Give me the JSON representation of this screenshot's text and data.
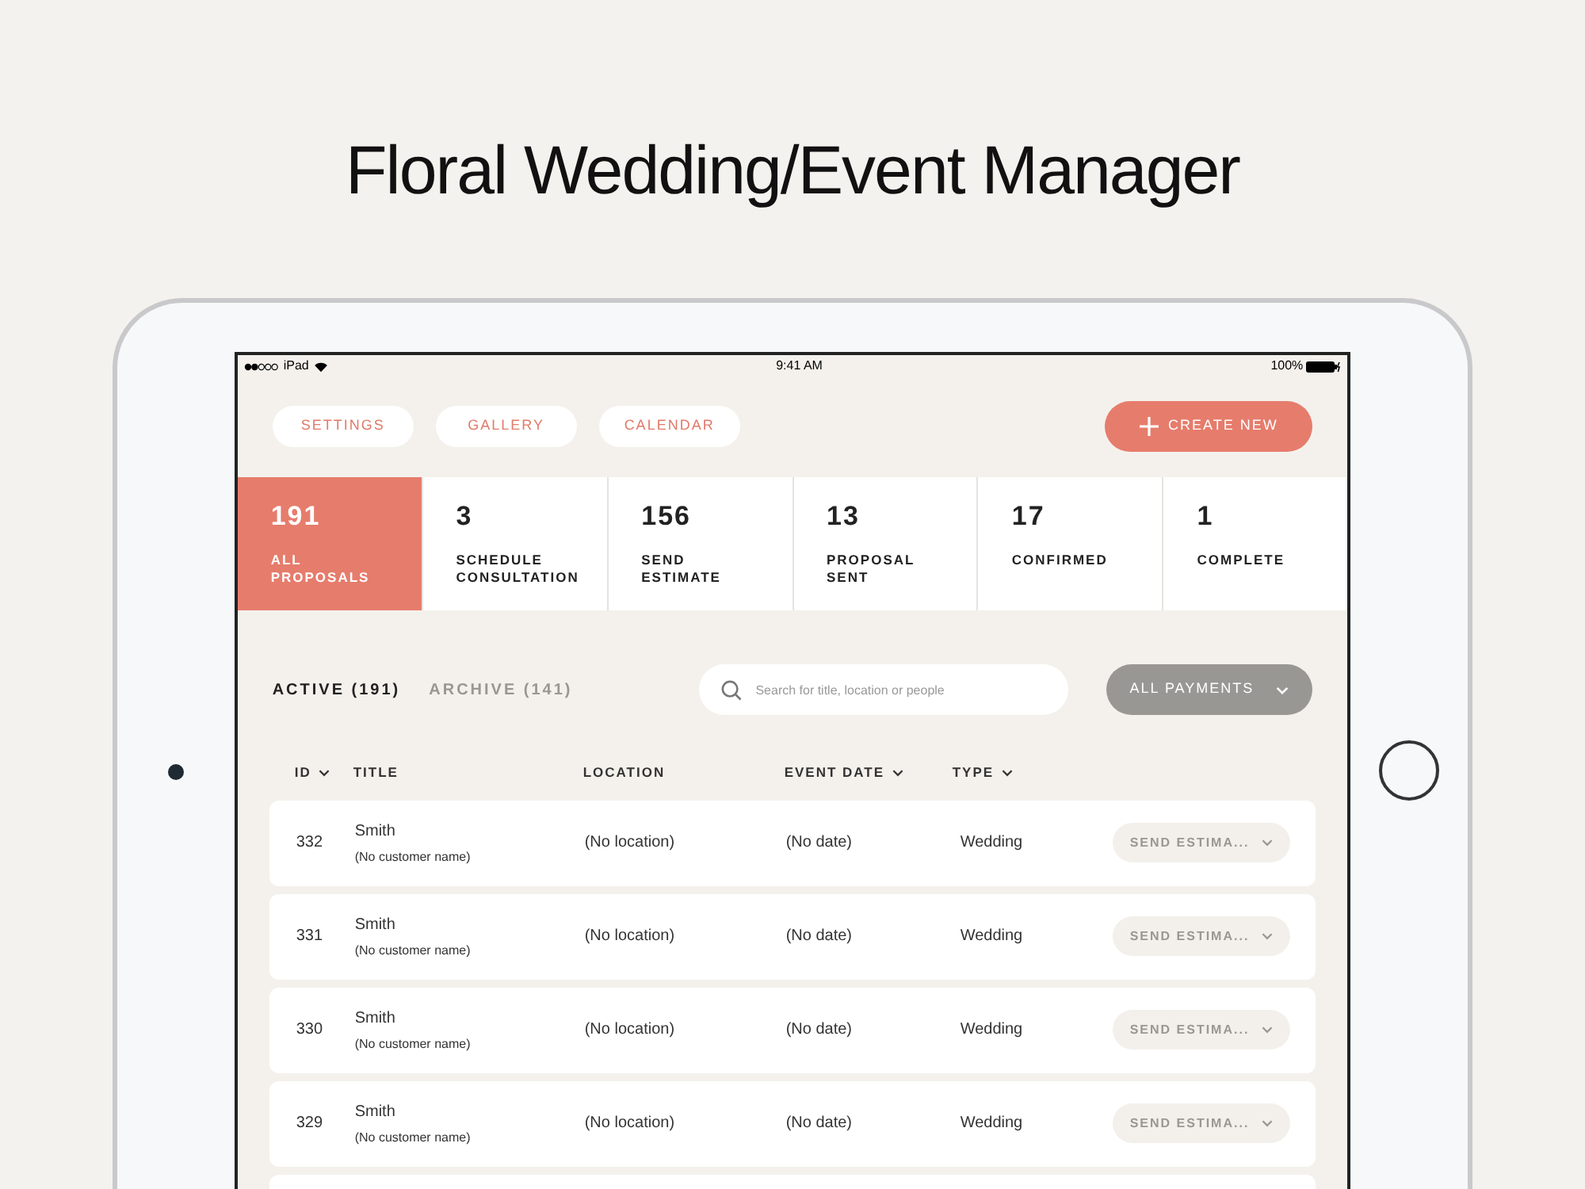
{
  "headline": "Floral Wedding/Event Manager",
  "status_bar": {
    "carrier": "iPad",
    "time": "9:41 AM",
    "battery": "100%"
  },
  "nav_buttons": [
    "SETTINGS",
    "GALLERY",
    "CALENDAR"
  ],
  "create_button": "CREATE NEW",
  "stats": [
    {
      "count": "191",
      "label": "ALL\nPROPOSALS",
      "selected": true
    },
    {
      "count": "3",
      "label": "SCHEDULE\nCONSULTATION",
      "selected": false
    },
    {
      "count": "156",
      "label": "SEND\nESTIMATE",
      "selected": false
    },
    {
      "count": "13",
      "label": "PROPOSAL\nSENT",
      "selected": false
    },
    {
      "count": "17",
      "label": "CONFIRMED",
      "selected": false
    },
    {
      "count": "1",
      "label": "COMPLETE",
      "selected": false
    }
  ],
  "tabs": [
    {
      "label": "ACTIVE (191)",
      "selected": true
    },
    {
      "label": "ARCHIVE (141)",
      "selected": false
    }
  ],
  "search": {
    "placeholder": "Search for title, location or people"
  },
  "payments_filter": "ALL PAYMENTS",
  "table": {
    "columns": [
      {
        "label": "ID",
        "sortable": true
      },
      {
        "label": "TITLE",
        "sortable": false
      },
      {
        "label": "LOCATION",
        "sortable": false
      },
      {
        "label": "EVENT DATE",
        "sortable": true
      },
      {
        "label": "TYPE",
        "sortable": true
      }
    ],
    "rows": [
      {
        "id": "332",
        "title": "Smith",
        "customer": "(No customer name)",
        "location": "(No location)",
        "date": "(No date)",
        "type": "Wedding",
        "status": "SEND ESTIMA..."
      },
      {
        "id": "331",
        "title": "Smith",
        "customer": "(No customer name)",
        "location": "(No location)",
        "date": "(No date)",
        "type": "Wedding",
        "status": "SEND ESTIMA..."
      },
      {
        "id": "330",
        "title": "Smith",
        "customer": "(No customer name)",
        "location": "(No location)",
        "date": "(No date)",
        "type": "Wedding",
        "status": "SEND ESTIMA..."
      },
      {
        "id": "329",
        "title": "Smith",
        "customer": "(No customer name)",
        "location": "(No location)",
        "date": "(No date)",
        "type": "Wedding",
        "status": "SEND ESTIMA..."
      }
    ]
  }
}
